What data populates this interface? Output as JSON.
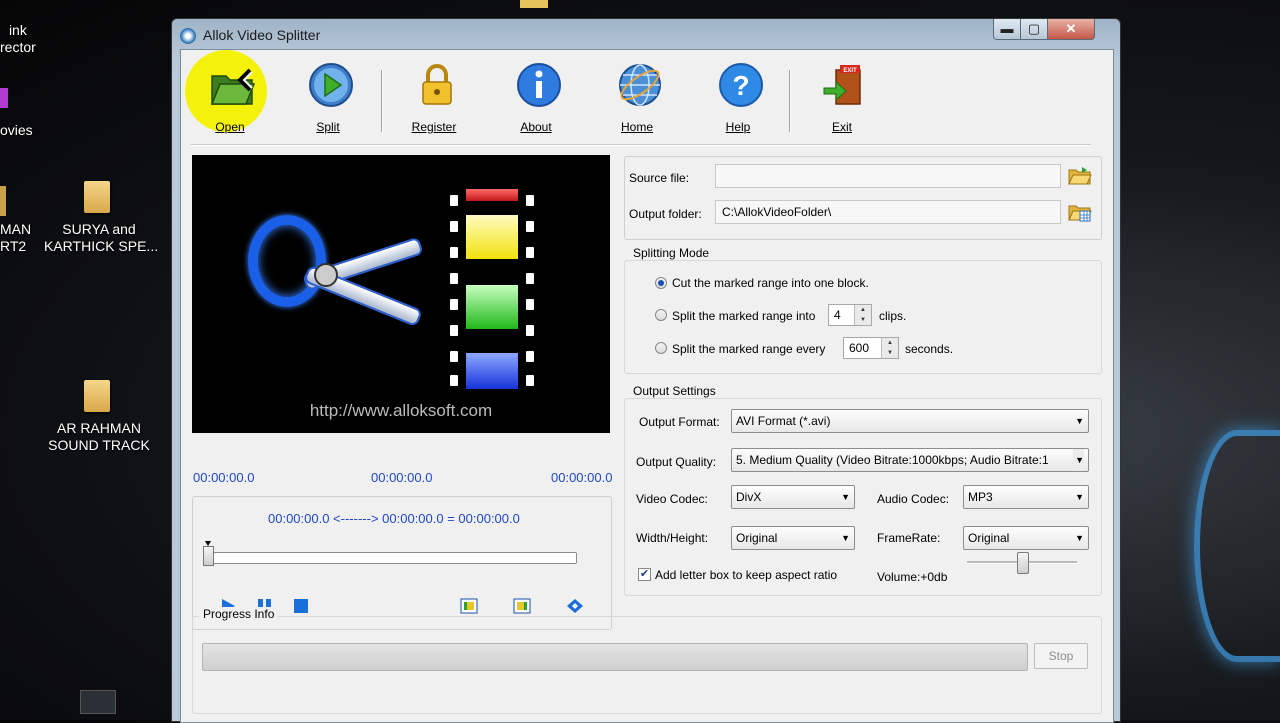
{
  "desktop": {
    "items": [
      {
        "label": "ink\nrector"
      },
      {
        "label": "ovies"
      },
      {
        "label": "MAN\nRT2"
      },
      {
        "label": "SURYA and\nKARTHICK SPE..."
      },
      {
        "label": "AR RAHMAN\nSOUND TRACK"
      }
    ]
  },
  "window": {
    "title": "Allok Video Splitter",
    "controls": {
      "minimize": "▬",
      "maximize": "▢",
      "close": "✕"
    }
  },
  "toolbar": {
    "buttons": [
      {
        "label": "Open",
        "icon": "folder-open-icon"
      },
      {
        "label": "Split",
        "icon": "play-circle-icon"
      },
      {
        "label": "Register",
        "icon": "lock-icon"
      },
      {
        "label": "About",
        "icon": "info-icon"
      },
      {
        "label": "Home",
        "icon": "globe-icon"
      },
      {
        "label": "Help",
        "icon": "help-icon"
      },
      {
        "label": "Exit",
        "icon": "exit-door-icon"
      }
    ]
  },
  "preview": {
    "url": "http://www.alloksoft.com",
    "time_left": "00:00:00.0",
    "time_mid": "00:00:00.0",
    "time_right": "00:00:00.0",
    "range_text": "00:00:00.0 <-------> 00:00:00.0 =  00:00:00.0"
  },
  "files": {
    "source_label": "Source file:",
    "source_value": "",
    "output_label": "Output folder:",
    "output_value": "C:\\AllokVideoFolder\\"
  },
  "splitting_mode": {
    "title": "Splitting Mode",
    "opt1": "Cut the marked range into one block.",
    "opt2_prefix": "Split the marked range into",
    "opt2_value": "4",
    "opt2_suffix": "clips.",
    "opt3_prefix": "Split the marked range every",
    "opt3_value": "600",
    "opt3_suffix": "seconds.",
    "selected": 1
  },
  "output_settings": {
    "title": "Output Settings",
    "format_label": "Output Format:",
    "format_value": "AVI Format (*.avi)",
    "quality_label": "Output Quality:",
    "quality_value": "5. Medium Quality   (Video Bitrate:1000kbps; Audio Bitrate:1",
    "vcodec_label": "Video Codec:",
    "vcodec_value": "DivX",
    "acodec_label": "Audio Codec:",
    "acodec_value": "MP3",
    "wh_label": "Width/Height:",
    "wh_value": "Original",
    "fr_label": "FrameRate:",
    "fr_value": "Original",
    "letterbox_label": "Add letter box to keep aspect ratio",
    "letterbox_checked": true,
    "volume_label": "Volume:+0db"
  },
  "progress": {
    "title": "Progress Info",
    "stop_label": "Stop"
  },
  "colors": {
    "timecode": "#1f48c8",
    "highlight": "#f4f20a"
  }
}
